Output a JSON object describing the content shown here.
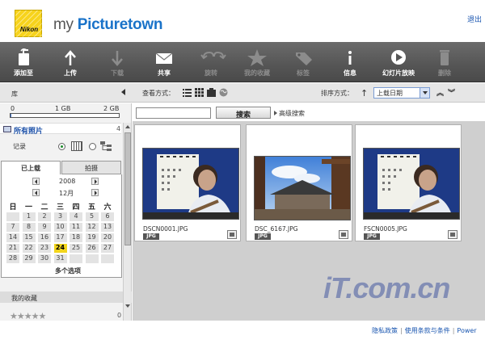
{
  "header": {
    "logo_text": "Nikon",
    "brand_prefix": "my ",
    "brand_name": "Picturetown",
    "logout": "退出"
  },
  "toolbar": {
    "items": [
      {
        "label": "添加至",
        "icon": "add-to-icon",
        "enabled": true
      },
      {
        "label": "上传",
        "icon": "upload-icon",
        "enabled": true
      },
      {
        "label": "下载",
        "icon": "download-icon",
        "enabled": false
      },
      {
        "label": "共享",
        "icon": "share-icon",
        "enabled": true
      },
      {
        "label": "旋转",
        "icon": "rotate-icon",
        "enabled": false
      },
      {
        "label": "我的收藏",
        "icon": "favorite-icon",
        "enabled": false
      },
      {
        "label": "标签",
        "icon": "tag-icon",
        "enabled": false
      },
      {
        "label": "信息",
        "icon": "info-icon",
        "enabled": true
      },
      {
        "label": "幻灯片放映",
        "icon": "slideshow-icon",
        "enabled": true
      },
      {
        "label": "删除",
        "icon": "delete-icon",
        "enabled": false
      }
    ]
  },
  "subbar": {
    "library_label": "库",
    "view_label": "查看方式：",
    "sort_label": "排序方式：",
    "sort_value": "上载日期"
  },
  "sidebar": {
    "storage": {
      "min": "0",
      "mid": "1 GB",
      "max": "2 GB",
      "used_fraction": 0.01
    },
    "all_photos_label": "所有照片",
    "all_photos_count": "4",
    "record_label": "记录",
    "tabs": [
      {
        "label": "已上载",
        "active": true
      },
      {
        "label": "拍摄",
        "active": false
      }
    ],
    "calendar": {
      "year": "2008",
      "month": "12月",
      "weekdays": [
        "日",
        "一",
        "二",
        "三",
        "四",
        "五",
        "六"
      ],
      "today": "24",
      "weeks": [
        [
          "",
          "1",
          "2",
          "3",
          "4",
          "5",
          "6"
        ],
        [
          "7",
          "8",
          "9",
          "10",
          "11",
          "12",
          "13"
        ],
        [
          "14",
          "15",
          "16",
          "17",
          "18",
          "19",
          "20"
        ],
        [
          "21",
          "22",
          "23",
          "24",
          "25",
          "26",
          "27"
        ],
        [
          "28",
          "29",
          "30",
          "31",
          "",
          "",
          ""
        ]
      ],
      "multi_select": "多个选项"
    },
    "favorites_label": "我的收藏",
    "favorites_stars": "★★★★★",
    "favorites_count": "0"
  },
  "search": {
    "value": "",
    "button_label": "搜索",
    "advanced_label": "高级搜索"
  },
  "photos": [
    {
      "filename": "DSCN0001.JPG",
      "type": "JPG",
      "scene": "portrait-calendar"
    },
    {
      "filename": "DSC_6167.JPG",
      "type": "JPG",
      "scene": "building-sky"
    },
    {
      "filename": "FSCN0005.JPG",
      "type": "JPG",
      "scene": "portrait-calendar"
    }
  ],
  "footer": {
    "watermark": "iT.com.cn",
    "privacy": "隐私政策",
    "terms": "使用条款与条件",
    "powered": "Power"
  },
  "colors": {
    "toolbar_bg": "#555555",
    "accent_blue": "#1a73c9",
    "today_yellow": "#f2d51c"
  }
}
